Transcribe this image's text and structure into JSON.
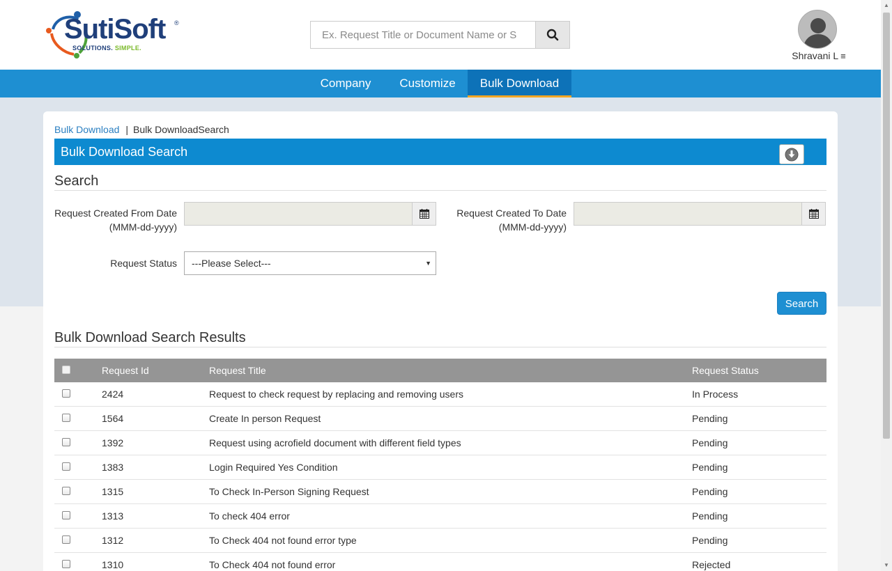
{
  "header": {
    "logo": {
      "word": "SutiSoft",
      "reg": "®",
      "tag_part1": "SOLUTIONS.",
      "tag_part2": "SIMPLE."
    },
    "search_placeholder": "Ex. Request Title or Document Name or S",
    "user_name": "Shravani L",
    "menu_icon": "hamburger-icon"
  },
  "nav": {
    "items": [
      {
        "label": "Company"
      },
      {
        "label": "Customize"
      },
      {
        "label": "Bulk Download",
        "active": true
      }
    ]
  },
  "breadcrumb": {
    "root": "Bulk Download",
    "separator": "|",
    "current": "Bulk DownloadSearch"
  },
  "panel_title": "Bulk Download Search",
  "search_section": {
    "title": "Search",
    "from_label_line1": "Request Created From Date",
    "from_label_line2": "(MMM-dd-yyyy)",
    "to_label_line1": "Request Created To Date",
    "to_label_line2": "(MMM-dd-yyyy)",
    "from_value": "",
    "to_value": "",
    "status_label": "Request Status",
    "status_selected": "---Please Select---",
    "search_button": "Search"
  },
  "results": {
    "title": "Bulk Download Search Results",
    "columns": [
      "Request Id",
      "Request Title",
      "Request Status"
    ],
    "rows": [
      {
        "id": "2424",
        "title": "Request to check request by replacing and removing users",
        "status": "In Process"
      },
      {
        "id": "1564",
        "title": "Create In person Request",
        "status": "Pending"
      },
      {
        "id": "1392",
        "title": "Request using acrofield document with different field types",
        "status": "Pending"
      },
      {
        "id": "1383",
        "title": "Login Required Yes Condition",
        "status": "Pending"
      },
      {
        "id": "1315",
        "title": "To Check In-Person Signing Request",
        "status": "Pending"
      },
      {
        "id": "1313",
        "title": "To check 404 error",
        "status": "Pending"
      },
      {
        "id": "1312",
        "title": "To Check 404 not found error type",
        "status": "Pending"
      },
      {
        "id": "1310",
        "title": "To Check 404 not found error",
        "status": "Rejected"
      }
    ]
  },
  "colors": {
    "nav_bg": "#1e8fd2",
    "nav_active": "#0d72b8",
    "active_underline": "#f5a623",
    "title_bar": "#0d8ad0",
    "table_header": "#959595"
  }
}
